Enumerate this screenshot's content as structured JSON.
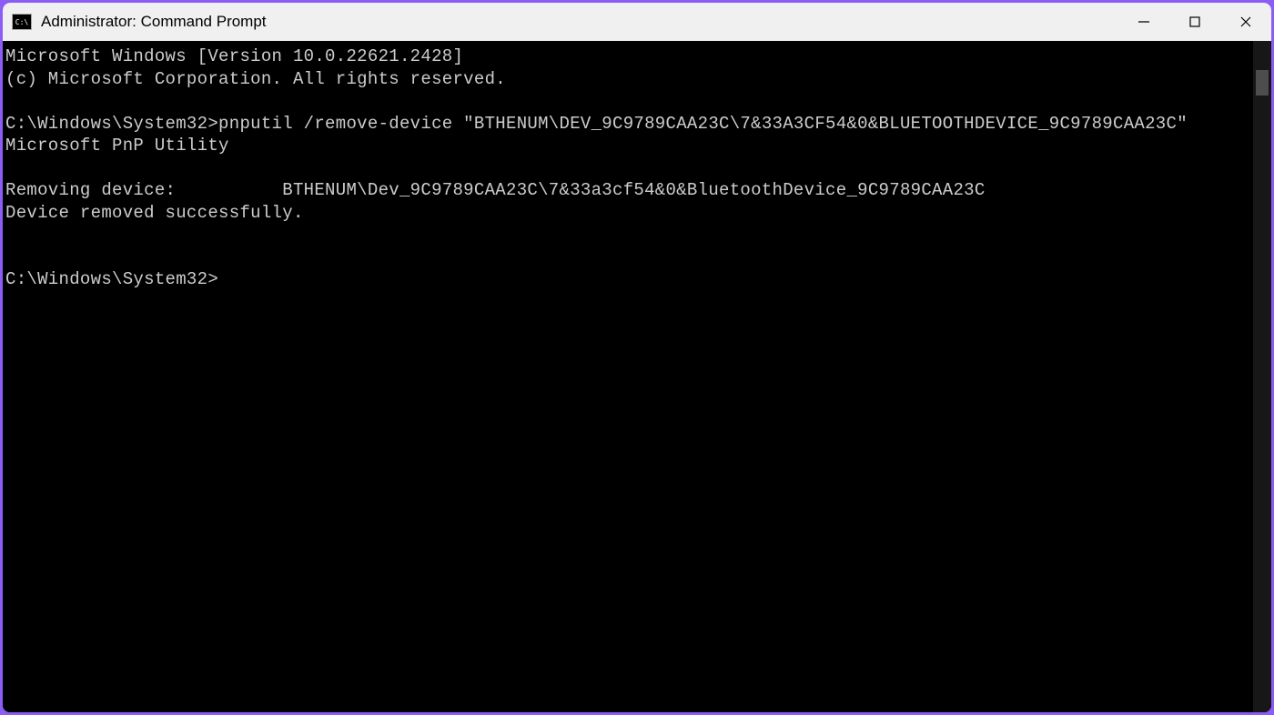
{
  "titlebar": {
    "icon_text": "C:\\",
    "title": "Administrator: Command Prompt"
  },
  "terminal": {
    "lines": [
      "Microsoft Windows [Version 10.0.22621.2428]",
      "(c) Microsoft Corporation. All rights reserved.",
      "",
      "C:\\Windows\\System32>pnputil /remove-device \"BTHENUM\\DEV_9C9789CAA23C\\7&33A3CF54&0&BLUETOOTHDEVICE_9C9789CAA23C\"",
      "Microsoft PnP Utility",
      "",
      "Removing device:          BTHENUM\\Dev_9C9789CAA23C\\7&33a3cf54&0&BluetoothDevice_9C9789CAA23C",
      "Device removed successfully.",
      "",
      "",
      "C:\\Windows\\System32>"
    ]
  }
}
